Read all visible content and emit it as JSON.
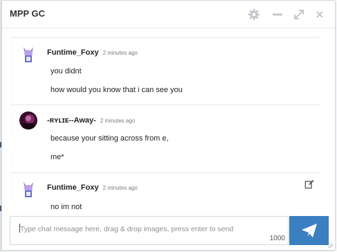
{
  "window": {
    "title": "MPP GC",
    "controls": [
      "gear-icon",
      "minimize-icon",
      "expand-icon",
      "close-icon"
    ]
  },
  "messages": [
    {
      "author": "Funtime_Foxy",
      "time": "2 minutes ago",
      "lines": [
        "you didnt",
        "how would you know that i can see you"
      ]
    },
    {
      "author": "-ʀʏʟɪᴇ--Away-",
      "time": "2 minutes ago",
      "lines": [
        "because your sitting across from e,",
        "me*"
      ]
    },
    {
      "author": "Funtime_Foxy",
      "time": "2 minutes ago",
      "lines": [
        "no im not"
      ]
    }
  ],
  "composer": {
    "placeholder": "Type chat message here, drag & drop images, press enter to send",
    "value": "",
    "char_remaining": "1000"
  },
  "colors": {
    "accent": "#3a7fc1",
    "border": "#cfd6dd",
    "text": "#222222"
  }
}
